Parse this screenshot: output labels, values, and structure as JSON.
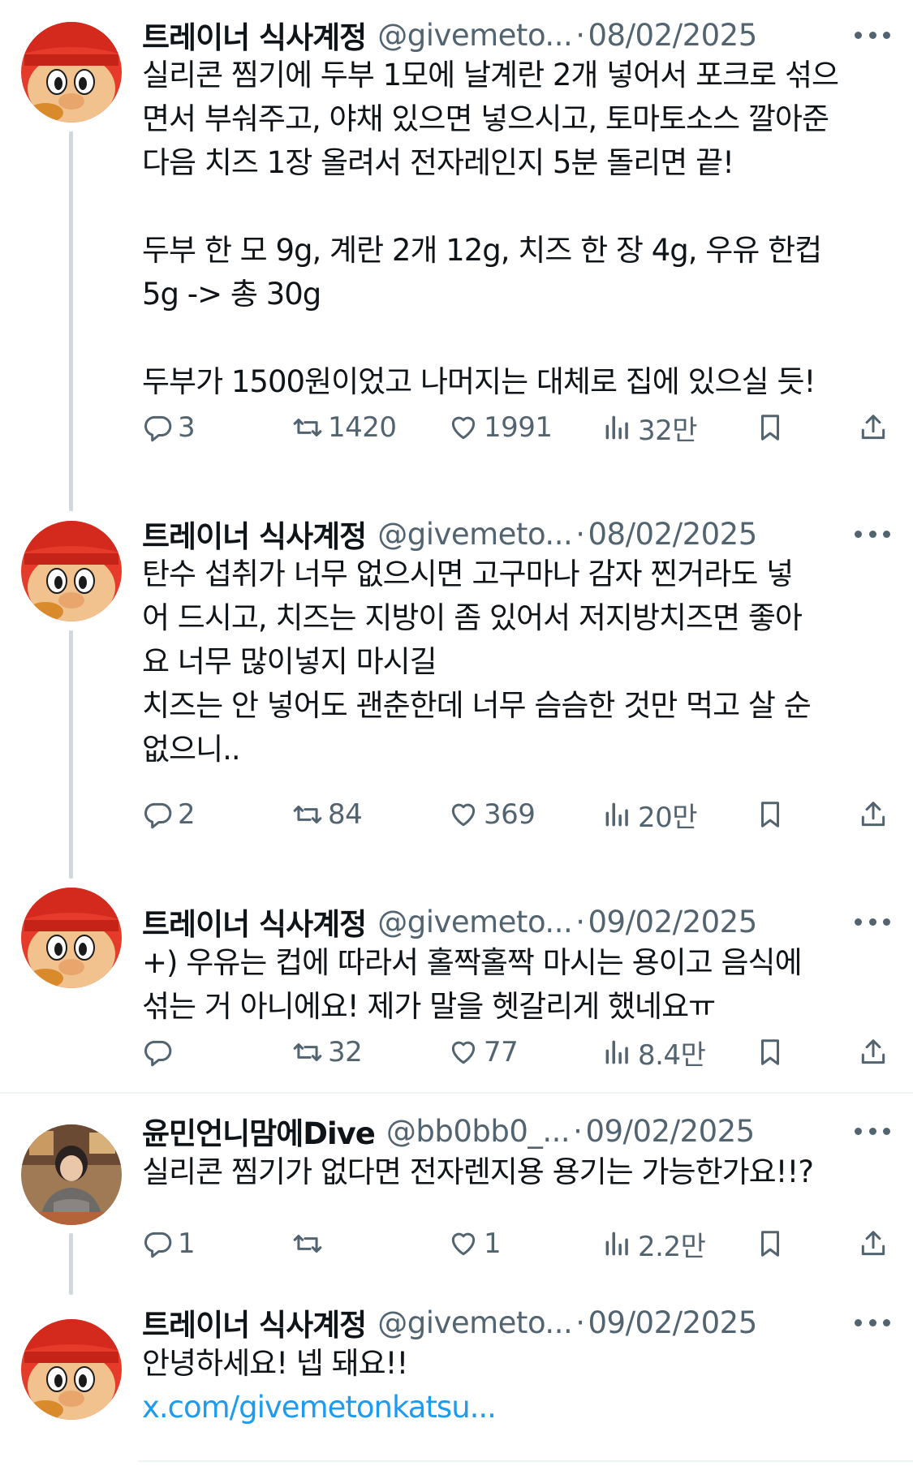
{
  "tweets": [
    {
      "name": "트레이너 식사계정",
      "handle": "@givemeto...",
      "date": "08/02/2025",
      "text": "실리콘 찜기에 두부 1모에 날계란 2개 넣어서 포크로 섞으\n면서 부숴주고, 야채 있으면 넣으시고, 토마토소스 깔아준\n다음 치즈 1장 올려서 전자레인지 5분 돌리면 끝!\n\n두부 한 모 9g, 계란 2개 12g, 치즈 한 장 4g, 우유 한컵\n5g -> 총 30g\n\n두부가 1500원이었고 나머지는 대체로 집에 있으실 듯!",
      "replies": "3",
      "retweets": "1420",
      "likes": "1991",
      "views": "32만"
    },
    {
      "name": "트레이너 식사계정",
      "handle": "@givemeto...",
      "date": "08/02/2025",
      "text": "탄수 섭취가 너무 없으시면 고구마나 감자 찐거라도 넣\n어 드시고, 치즈는 지방이 좀 있어서 저지방치즈면 좋아\n요 너무 많이넣지 마시길\n치즈는 안 넣어도 괜춘한데 너무 슴슴한 것만 먹고 살 순\n없으니..",
      "replies": "2",
      "retweets": "84",
      "likes": "369",
      "views": "20만"
    },
    {
      "name": "트레이너 식사계정",
      "handle": "@givemeto...",
      "date": "09/02/2025",
      "text": "+) 우유는 컵에 따라서 홀짝홀짝 마시는 용이고 음식에\n섞는 거 아니에요! 제가 말을 헷갈리게 했네요ㅠ",
      "replies": "",
      "retweets": "32",
      "likes": "77",
      "views": "8.4만"
    },
    {
      "name": "윤민언니맘에Dive",
      "handle": "@bb0bb0_...",
      "date": "09/02/2025",
      "text": "실리콘 찜기가 없다면 전자렌지용 용기는 가능한가요!!?",
      "replies": "1",
      "retweets": "",
      "likes": "1",
      "views": "2.2만"
    },
    {
      "name": "트레이너 식사계정",
      "handle": "@givemeto...",
      "date": "09/02/2025",
      "text": "안녕하세요! 넵 돼요!!",
      "link": "x.com/givemetonkatsu..."
    }
  ],
  "separator": "·",
  "icons": {
    "reply": "reply-icon",
    "retweet": "retweet-icon",
    "like": "heart-icon",
    "views": "views-icon",
    "bookmark": "bookmark-icon",
    "share": "share-icon",
    "more": "more-icon"
  },
  "colors": {
    "text": "#0f1419",
    "secondary": "#536471",
    "link": "#1d9bf0",
    "thread_line": "#cfd9de",
    "divider": "#eff3f4"
  }
}
